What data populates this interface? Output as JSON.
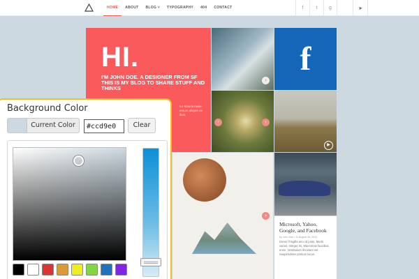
{
  "nav": {
    "items": [
      "HOME",
      "ABOUT",
      "BLOG ˅",
      "TYPOGRAPHY",
      "404",
      "CONTACT"
    ],
    "social": [
      "f",
      "t",
      "g"
    ],
    "go_icon": "arrow-right-icon"
  },
  "hero": {
    "big": "HI.",
    "text": "I'M JOHN DOE. A DESIGNER FROM SF THIS IS MY BLOG TO SHARE STUFF AND THINKS",
    "small": "tur mauris male- entum aliquet ex ibus."
  },
  "facebook_tile": {
    "glyph": "f"
  },
  "article": {
    "title": "Microsoft, Yahoo, Google, and Facebook",
    "meta": "by John Doe • 11 August 30, 2012",
    "body": "Donec fringilla arcu id justo. Morbi varius. Integer mi. Maecenas faucibus enim. Vestibulum tincidunt vel. Suspendisse pretium lacus."
  },
  "picker": {
    "title": "Background Color",
    "current_label": "Current Color",
    "hex_value": "#ccd9e0",
    "clear_label": "Clear",
    "current_color": "#ccd9e0",
    "palette": [
      "#000000",
      "#ffffff",
      "#dd3333",
      "#dd9933",
      "#eeee22",
      "#81d742",
      "#1e73be",
      "#8224e3"
    ]
  },
  "colors": {
    "page_bg": "#ccd9e0",
    "hero_bg": "#fb5a5d",
    "facebook_bg": "#1366b8",
    "picker_border": "#f3c021",
    "accent": "#e8584f"
  }
}
